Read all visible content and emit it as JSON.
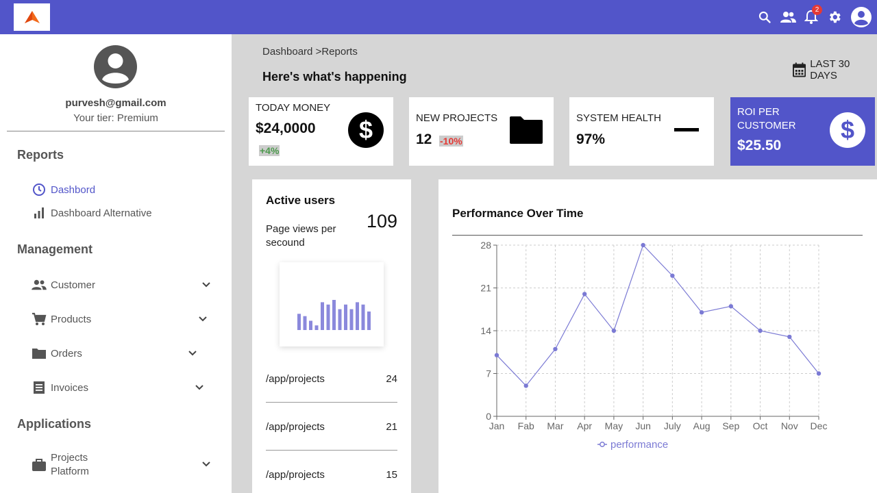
{
  "topbar": {
    "notification_count": "2",
    "icons": [
      "search-icon",
      "group-icon",
      "notifications-icon",
      "settings-icon",
      "account-icon"
    ],
    "brand_color": "#5255c9"
  },
  "sidebar": {
    "user": {
      "email": "purvesh@gmail.com",
      "tier": "Your tier: Premium"
    },
    "sections": {
      "reports": "Reports",
      "management": "Management",
      "applications": "Applications"
    },
    "items": {
      "dashbord": "Dashbord",
      "dashboard_alt": "Dashboard Alternative",
      "customer": "Customer",
      "products": "Products",
      "orders": "Orders",
      "invoices": "Invoices",
      "projects_platform_1": "Projects",
      "projects_platform_2": "Platform"
    }
  },
  "header": {
    "breadcrumb_root": "Dashboard",
    "breadcrumb_sep": ">",
    "breadcrumb_current": "Reports",
    "heading": "Here's what's happening",
    "date_range": "LAST 30 DAYS"
  },
  "stats": {
    "today_money": {
      "label": "TODAY MONEY",
      "value": "$24,0000",
      "delta": "+4%",
      "delta_color": "#2e7d32"
    },
    "new_projects": {
      "label": "NEW PROJECTS",
      "value": "12",
      "delta": "-10%",
      "delta_color": "#e53935"
    },
    "system_health": {
      "label": "SYSTEM HEALTH",
      "value": "97%"
    },
    "roi": {
      "label_1": "ROI PER",
      "label_2": "CUSTOMER",
      "value": "$25.50"
    }
  },
  "active_users": {
    "title": "Active users",
    "page_views_label": "Page views per secound",
    "page_views_value": "109",
    "mini_bars": [
      7,
      6,
      4,
      2,
      12,
      11,
      13,
      9,
      11,
      9,
      12,
      11,
      8
    ],
    "pages": [
      {
        "path": "/app/projects",
        "count": "24"
      },
      {
        "path": "/app/projects",
        "count": "21"
      },
      {
        "path": "/app/projects",
        "count": "15"
      }
    ]
  },
  "performance": {
    "title": "Performance Over Time"
  },
  "chart_data": {
    "type": "line",
    "categories": [
      "Jan",
      "Fab",
      "Mar",
      "Apr",
      "May",
      "Jun",
      "July",
      "Aug",
      "Sep",
      "Oct",
      "Nov",
      "Dec"
    ],
    "series": [
      {
        "name": "performance",
        "values": [
          10,
          5,
          11,
          20,
          14,
          28,
          23,
          17,
          18,
          14,
          13,
          7
        ],
        "color": "#7b7ad4"
      }
    ],
    "yticks": [
      0,
      7,
      14,
      21,
      28
    ],
    "ylim": [
      0,
      28
    ],
    "grid": true,
    "legend": "bottom"
  }
}
